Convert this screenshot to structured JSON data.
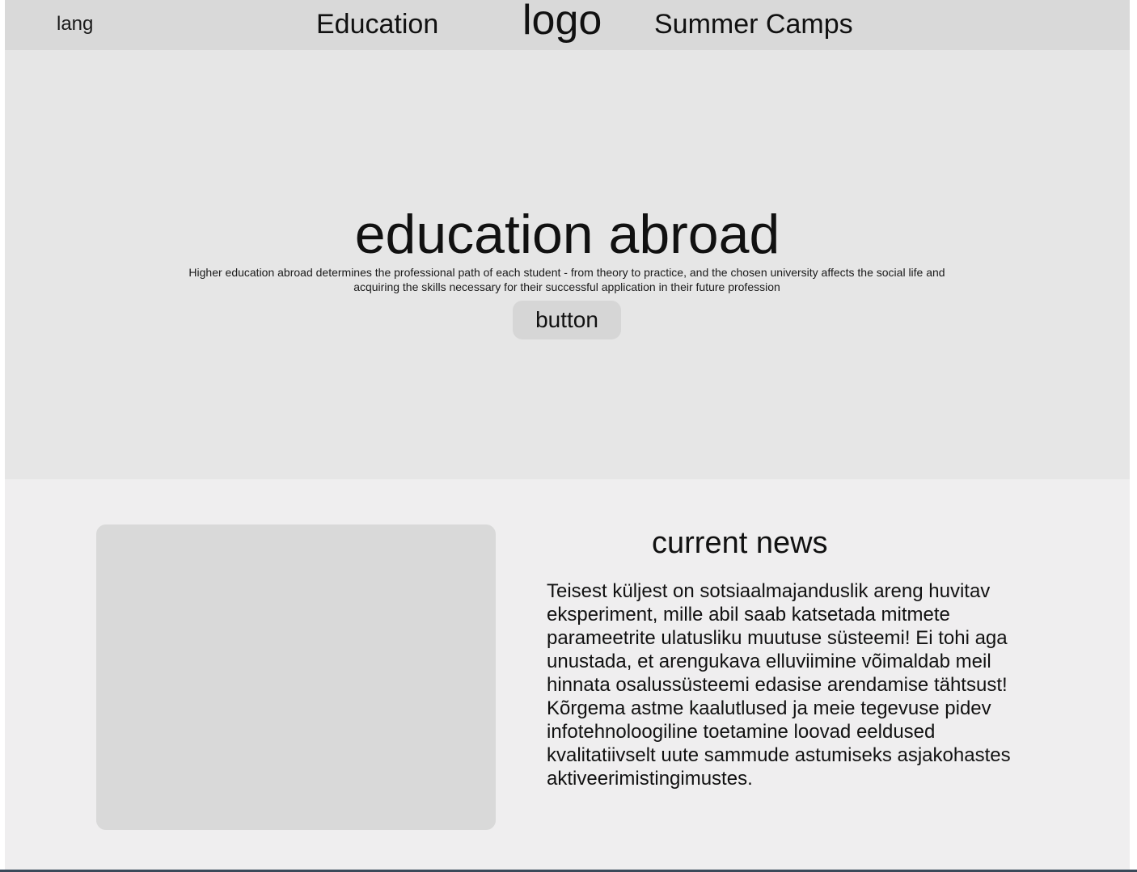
{
  "header": {
    "lang_label": "lang",
    "nav_education": "Education",
    "logo": "logo",
    "nav_summer_camps": "Summer Camps"
  },
  "hero": {
    "title": "education abroad",
    "text": "Higher education abroad determines the professional path of each student - from theory to practice, and the chosen university affects the social life and acquiring the skills necessary for their successful application in their future profession",
    "button_label": "button"
  },
  "news": {
    "title": "current news",
    "body": "Teisest küljest on sotsiaalmajanduslik areng huvitav eksperiment, mille abil saab katsetada mitmete parameetrite ulatusliku muutuse süsteemi! Ei tohi aga unustada, et arengukava elluviimine võimaldab meil hinnata osalussüsteemi edasise arendamise tähtsust! Kõrgema astme kaalutlused ja meie tegevuse pidev infotehnoloogiline toetamine loovad eeldused kvalitatiivselt uute sammude astumiseks asjakohastes aktiveerimistingimustes."
  },
  "colors": {
    "header_bg": "#d9d9d9",
    "hero_bg": "#e6e6e6",
    "section_bg": "#efeeef",
    "placeholder_bg": "#d9d9d9",
    "button_bg": "#d6d6d6"
  }
}
